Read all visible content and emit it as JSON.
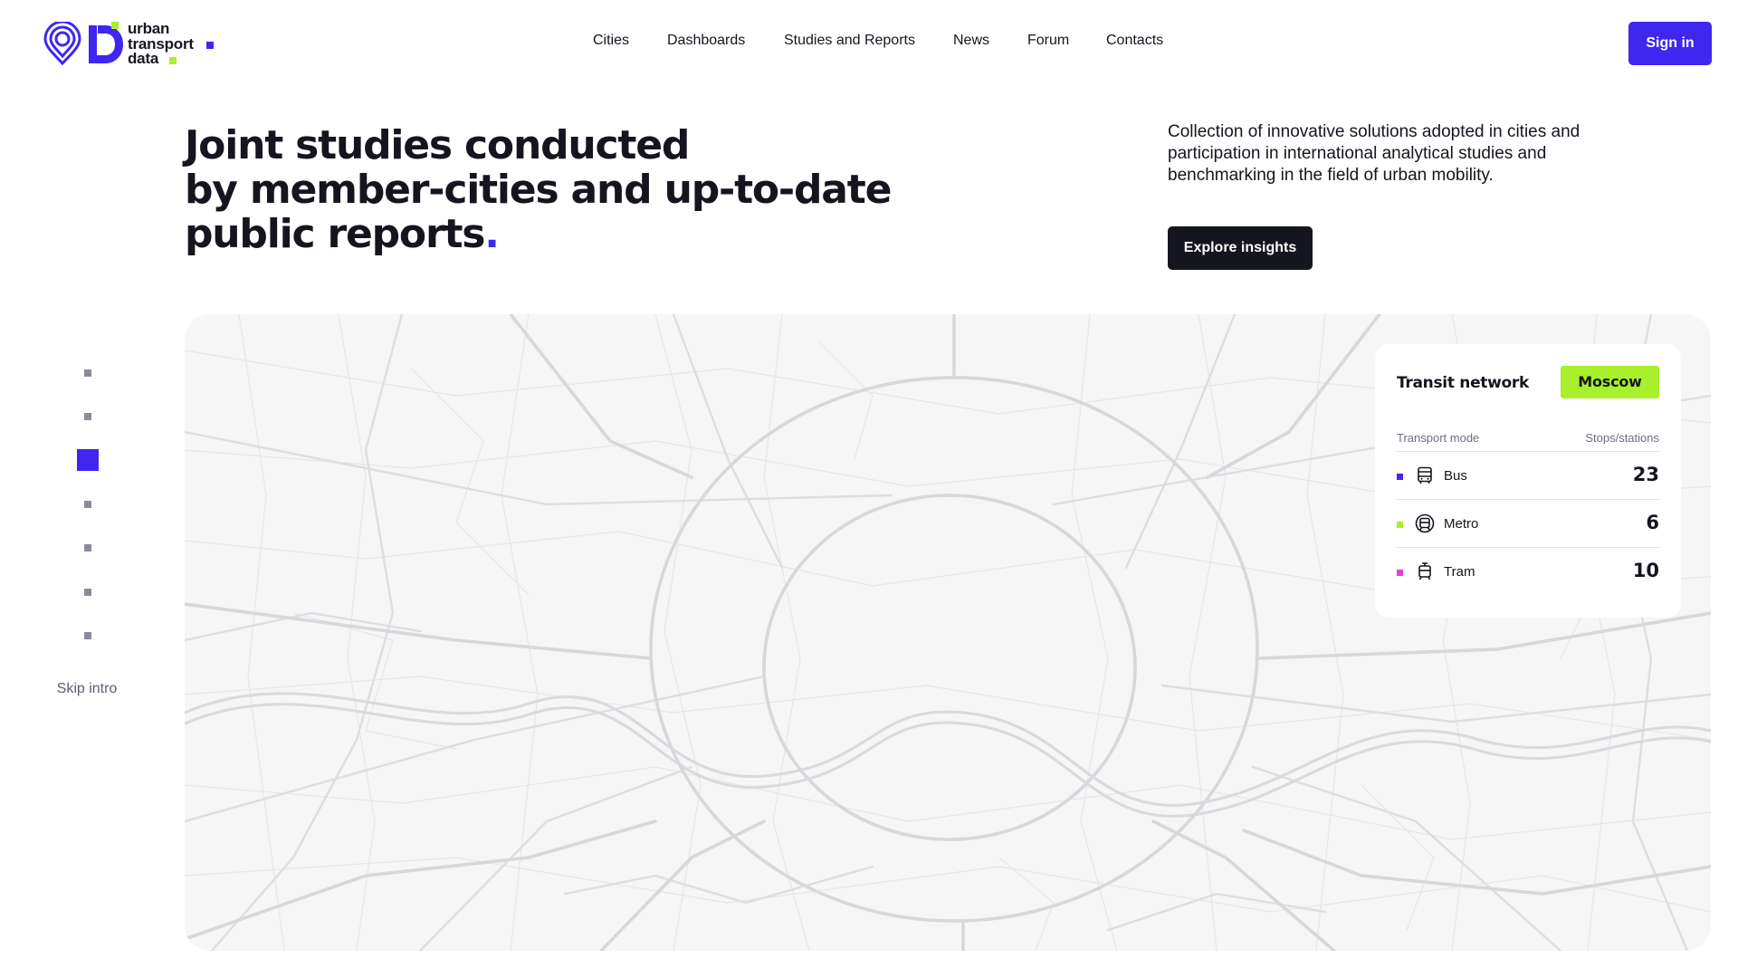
{
  "brand": {
    "logo_lines": [
      "urban",
      "transport",
      "data"
    ],
    "accent": "#3f27f0",
    "lime": "#a8f02c"
  },
  "nav": [
    "Cities",
    "Dashboards",
    "Studies and Reports",
    "News",
    "Forum",
    "Contacts"
  ],
  "header": {
    "signin_label": "Sign in"
  },
  "hero": {
    "title_lines": [
      "Joint studies conducted",
      "by member-cities and up-to-date",
      "public reports"
    ],
    "title_dot": ".",
    "description": "Collection of innovative solutions adopted in cities and participation in international analytical studies and benchmarking in the field of urban mobility.",
    "cta_label": "Explore insights"
  },
  "pager": {
    "count": 7,
    "active_index": 2,
    "skip_label": "Skip intro"
  },
  "transit_card": {
    "title": "Transit network",
    "city": "Moscow",
    "col_mode": "Transport mode",
    "col_count": "Stops/stations",
    "rows": [
      {
        "mode": "Bus",
        "count": "23",
        "color": "#3f27f0",
        "icon": "bus-icon"
      },
      {
        "mode": "Metro",
        "count": "6",
        "color": "#a8f02c",
        "icon": "metro-icon"
      },
      {
        "mode": "Tram",
        "count": "10",
        "color": "#e83cd6",
        "icon": "tram-icon"
      }
    ]
  }
}
